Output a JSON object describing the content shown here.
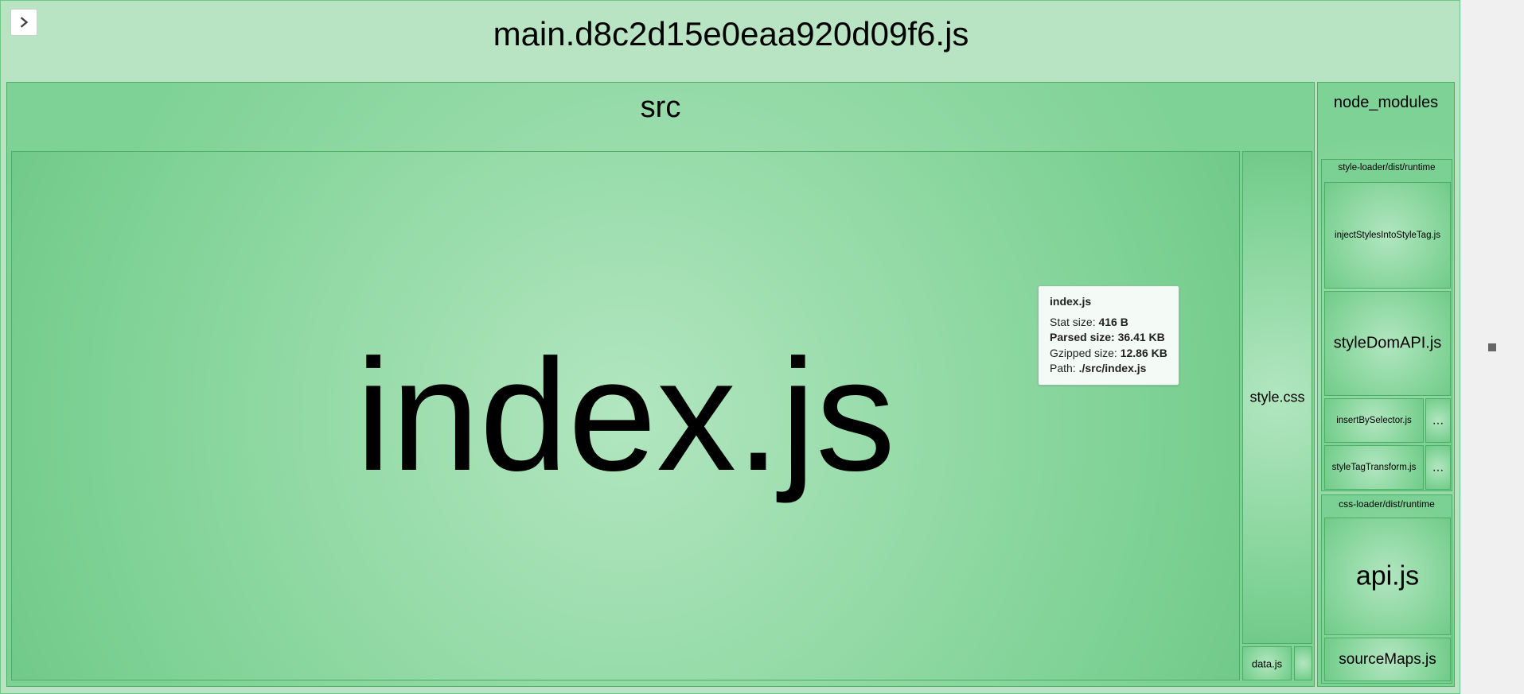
{
  "bundle": {
    "title": "main.d8c2d15e0eaa920d09f6.js"
  },
  "src": {
    "label": "src",
    "index": "index.js",
    "stylecss": "style.css",
    "datajs": "data.js"
  },
  "node_modules": {
    "label": "node_modules",
    "style_loader": {
      "label": "style-loader/dist/runtime",
      "inject": "injectStylesIntoStyleTag.js",
      "styledom": "styleDomAPI.js",
      "insertBy": "insertBySelector.js",
      "styleTag": "styleTagTransform.js",
      "ell1": "…",
      "ell2": "…"
    },
    "css_loader": {
      "label": "css-loader/dist/runtime",
      "api": "api.js",
      "sourceMaps": "sourceMaps.js"
    }
  },
  "tooltip": {
    "title": "index.js",
    "stat_label": "Stat size: ",
    "stat_value": "416 B",
    "parsed_label": "Parsed size: ",
    "parsed_value": "36.41 KB",
    "gzip_label": "Gzipped size: ",
    "gzip_value": "12.86 KB",
    "path_label": "Path: ",
    "path_value": "./src/index.js"
  }
}
